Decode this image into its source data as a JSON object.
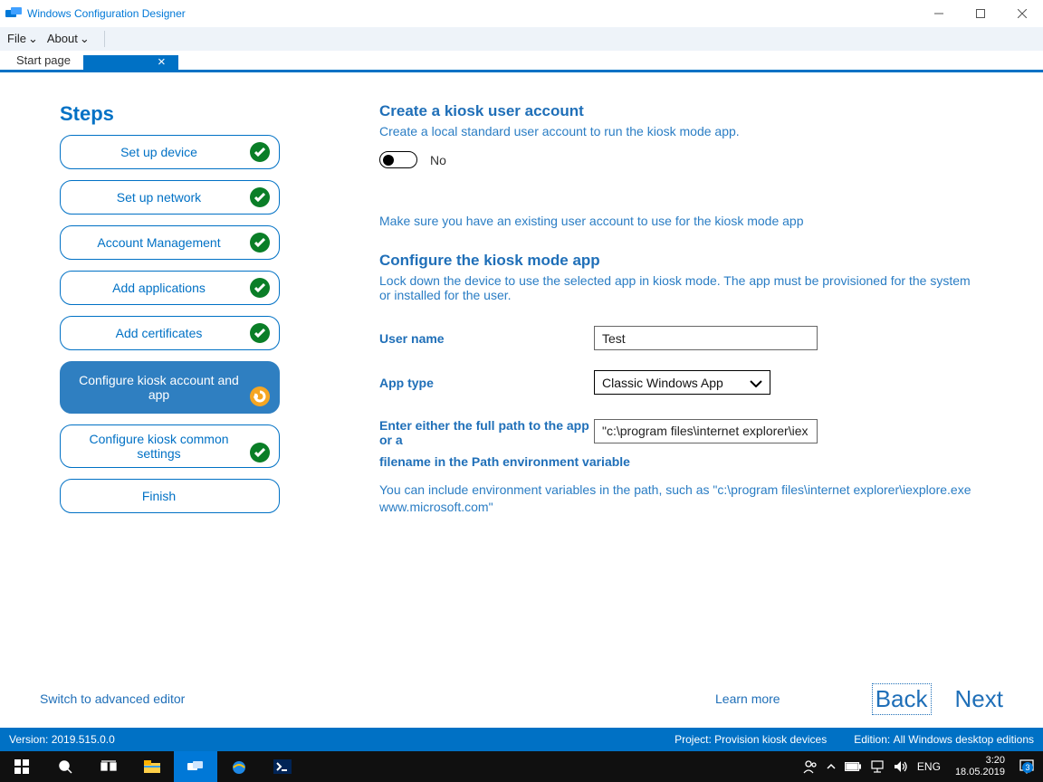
{
  "app": {
    "title": "Windows Configuration Designer"
  },
  "menu": {
    "file": "File",
    "about": "About"
  },
  "tabs": {
    "start": "Start page",
    "project": "               "
  },
  "steps_heading": "Steps",
  "steps": [
    {
      "label": "Set up device",
      "status": "done"
    },
    {
      "label": "Set up network",
      "status": "done"
    },
    {
      "label": "Account Management",
      "status": "done"
    },
    {
      "label": "Add applications",
      "status": "done"
    },
    {
      "label": "Add certificates",
      "status": "done"
    },
    {
      "label": "Configure kiosk account and app",
      "status": "active_pending"
    },
    {
      "label": "Configure kiosk common settings",
      "status": "done"
    },
    {
      "label": "Finish",
      "status": "none"
    }
  ],
  "content": {
    "section1": {
      "heading": "Create a kiosk user account",
      "desc": "Create a local standard user account to run the kiosk mode app.",
      "toggle_value": "No"
    },
    "info_line": "Make sure you have an existing user account to use for the kiosk mode app",
    "section2": {
      "heading": "Configure the kiosk mode app",
      "desc": "Lock down the device to use the selected app in kiosk mode. The app must be provisioned for the system or installed for the user."
    },
    "form": {
      "username_label": "User name",
      "username_value": "Test",
      "apptype_label": "App type",
      "apptype_value": "Classic Windows App",
      "path_label_part1": "Enter either the full path to the app or a",
      "path_value": "\"c:\\program files\\internet explorer\\iex",
      "path_label_part2": "filename in the Path environment variable",
      "help": "You can include environment variables in the path, such as \"c:\\program files\\internet explorer\\iexplore.exe www.microsoft.com\""
    }
  },
  "bottom": {
    "switch": "Switch to advanced editor",
    "learn": "Learn more",
    "back": "Back",
    "next": "Next"
  },
  "status": {
    "version": "Version:  2019.515.0.0",
    "project_label": "Project:",
    "project_value": "Provision kiosk devices",
    "edition_label": "Edition:",
    "edition_value": "All Windows desktop editions"
  },
  "taskbar": {
    "lang": "ENG",
    "time": "3:20",
    "date": "18.05.2019",
    "notif_count": "3"
  }
}
